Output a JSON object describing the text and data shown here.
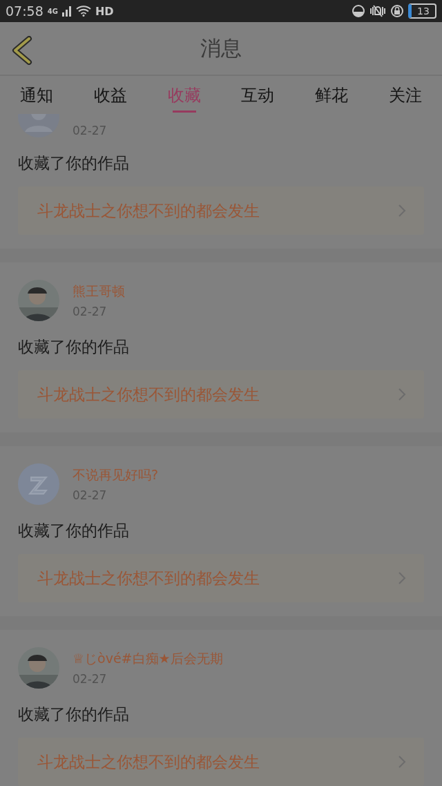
{
  "status_bar": {
    "time": "07:58",
    "network": "4G",
    "hd": "HD",
    "battery": "13"
  },
  "header": {
    "title": "消息"
  },
  "tabs": [
    {
      "label": "通知",
      "selected": false
    },
    {
      "label": "收益",
      "selected": false
    },
    {
      "label": "收藏",
      "selected": true
    },
    {
      "label": "互动",
      "selected": false
    },
    {
      "label": "鲜花",
      "selected": false
    },
    {
      "label": "关注",
      "selected": false
    }
  ],
  "messages": [
    {
      "avatar": {
        "kind": "silhouette"
      },
      "date": "02-27",
      "action": "收藏了你的作品",
      "work": "斗龙战士之你想不到的都会发生"
    },
    {
      "name": "熊王哥顿",
      "date": "02-27",
      "action": "收藏了你的作品",
      "work": "斗龙战士之你想不到的都会发生"
    },
    {
      "avatar": {
        "kind": "logo"
      },
      "name": "不说再见好吗?",
      "date": "02-27",
      "action": "收藏了你的作品",
      "work": "斗龙战士之你想不到的都会发生"
    },
    {
      "name": "♕じòvé#白痴★后会无期",
      "date": "02-27",
      "action": "收藏了你的作品",
      "work": "斗龙战士之你想不到的都会发生"
    }
  ]
}
